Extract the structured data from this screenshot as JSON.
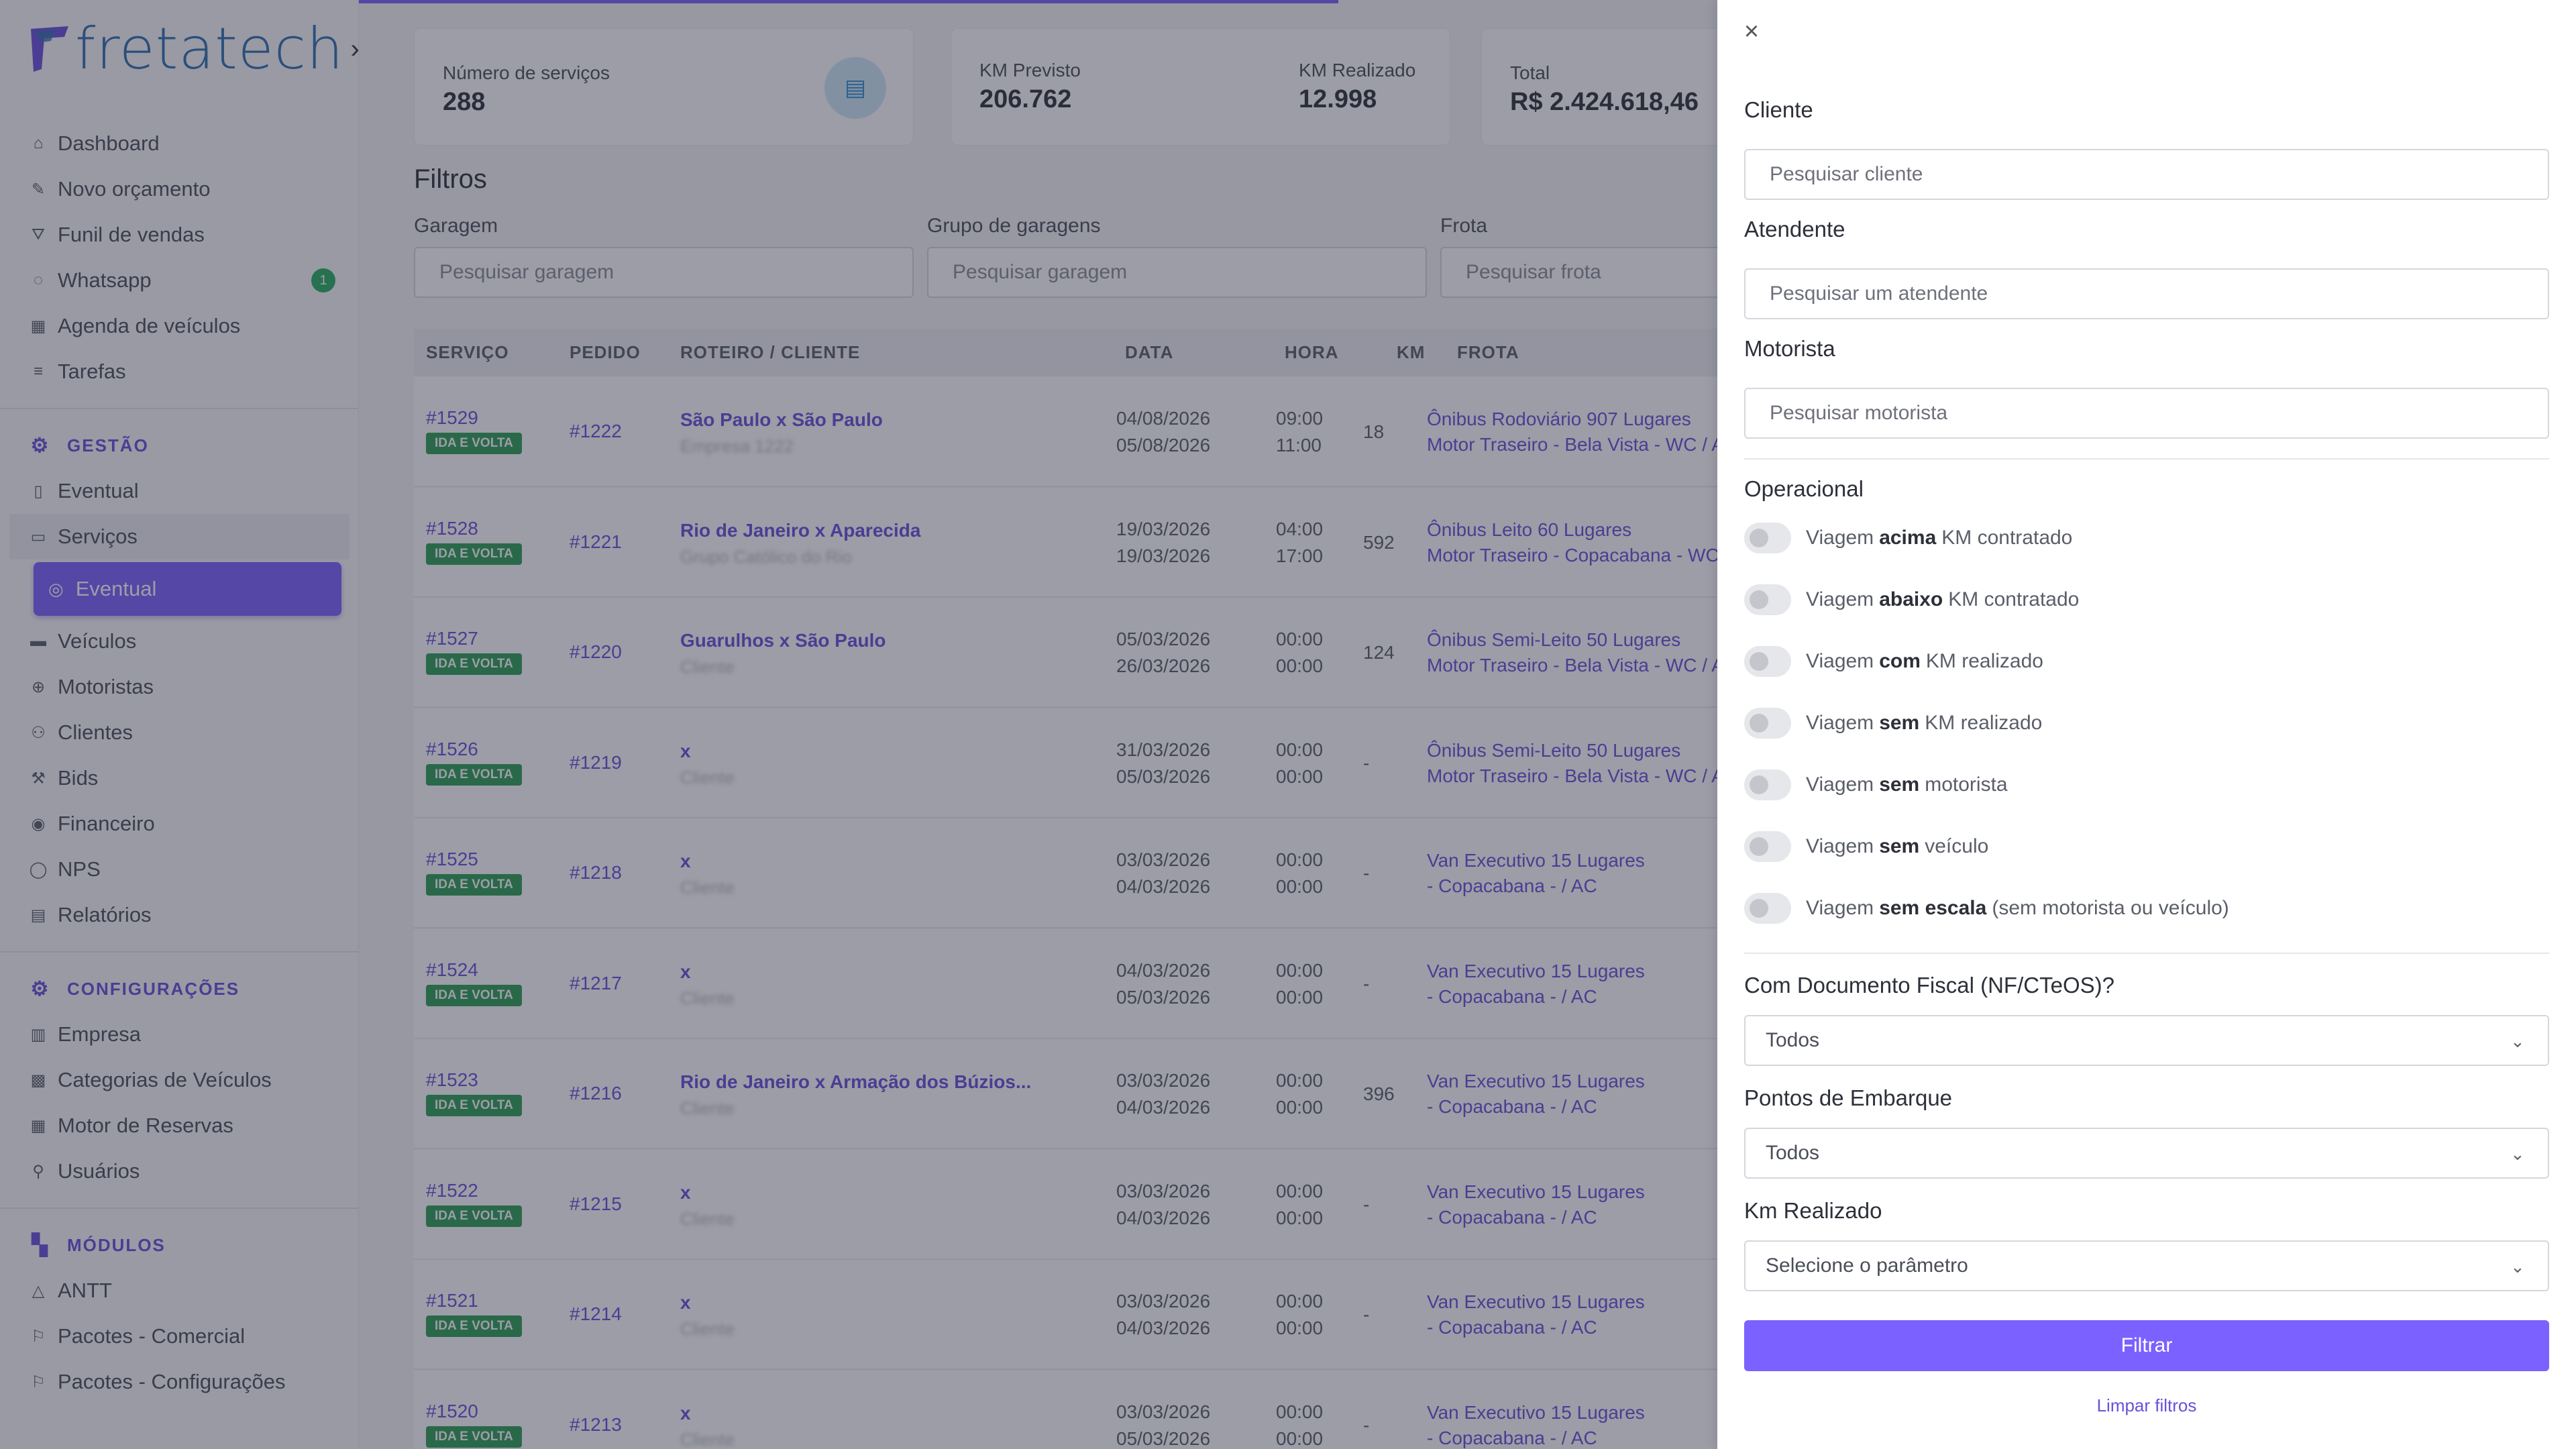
{
  "brand": {
    "name_a": "freta",
    "name_b": "tech",
    "chevron": "›"
  },
  "sidebar": {
    "items_top": [
      {
        "icon": "home-icon",
        "glyph": "⌂",
        "label": "Dashboard"
      },
      {
        "icon": "edit-icon",
        "glyph": "✎",
        "label": "Novo orçamento"
      },
      {
        "icon": "funnel-icon",
        "glyph": "⛛",
        "label": "Funil de vendas"
      },
      {
        "icon": "whatsapp-icon",
        "glyph": "◌",
        "label": "Whatsapp",
        "badge": "1"
      },
      {
        "icon": "calendar-icon",
        "glyph": "▦",
        "label": "Agenda de veículos"
      },
      {
        "icon": "list-icon",
        "glyph": "≡",
        "label": "Tarefas"
      }
    ],
    "gestao": {
      "title": "GESTÃO",
      "items": [
        {
          "icon": "file-icon",
          "glyph": "▯",
          "label": "Eventual"
        },
        {
          "icon": "services-icon",
          "glyph": "▭",
          "label": "Serviços"
        },
        {
          "icon": "circle-icon",
          "glyph": "◎",
          "label": "Eventual",
          "active": true
        },
        {
          "icon": "bus-icon",
          "glyph": "▬",
          "label": "Veículos"
        },
        {
          "icon": "steering-icon",
          "glyph": "⊕",
          "label": "Motoristas"
        },
        {
          "icon": "users-icon",
          "glyph": "⚇",
          "label": "Clientes"
        },
        {
          "icon": "gavel-icon",
          "glyph": "⚒",
          "label": "Bids"
        },
        {
          "icon": "money-icon",
          "glyph": "◉",
          "label": "Financeiro"
        },
        {
          "icon": "chat-icon",
          "glyph": "◯",
          "label": "NPS"
        },
        {
          "icon": "report-icon",
          "glyph": "▤",
          "label": "Relatórios"
        }
      ]
    },
    "config": {
      "title": "CONFIGURAÇÕES",
      "items": [
        {
          "icon": "building-icon",
          "glyph": "▥",
          "label": "Empresa"
        },
        {
          "icon": "grid-icon",
          "glyph": "▩",
          "label": "Categorias de Veículos"
        },
        {
          "icon": "table-icon",
          "glyph": "▦",
          "label": "Motor de Reservas"
        },
        {
          "icon": "user-icon",
          "glyph": "⚲",
          "label": "Usuários"
        }
      ]
    },
    "modulos": {
      "title": "MÓDULOS",
      "items": [
        {
          "icon": "warning-icon",
          "glyph": "△",
          "label": "ANTT"
        },
        {
          "icon": "package-icon",
          "glyph": "⚐",
          "label": "Pacotes - Comercial"
        },
        {
          "icon": "package-config-icon",
          "glyph": "⚐",
          "label": "Pacotes - Configurações"
        }
      ]
    }
  },
  "stats": {
    "services_label": "Número de serviços",
    "services_value": "288",
    "km_prev_label": "KM Previsto",
    "km_prev_value": "206.762",
    "km_real_label": "KM Realizado",
    "km_real_value": "12.998",
    "total_label": "Total",
    "total_value": "R$ 2.424.618,46"
  },
  "filters": {
    "title": "Filtros",
    "garagem_label": "Garagem",
    "garagem_placeholder": "Pesquisar garagem",
    "grupo_label": "Grupo de garagens",
    "grupo_placeholder": "Pesquisar garagem",
    "frota_label": "Frota",
    "frota_placeholder": "Pesquisar frota"
  },
  "table": {
    "headers": [
      "SERVIÇO",
      "PEDIDO",
      "ROTEIRO / CLIENTE",
      "DATA",
      "HORA",
      "KM",
      "FROTA"
    ],
    "rows": [
      {
        "svc": "#1529",
        "tag": "IDA E VOLTA",
        "ped": "#1222",
        "route": "São Paulo x São Paulo",
        "client": "Empresa 1222",
        "d1": "04/08/2026",
        "d2": "05/08/2026",
        "h1": "09:00",
        "h2": "11:00",
        "km": "18",
        "f1": "Ônibus Rodoviário 907 Lugares",
        "f2": "Motor Traseiro - Bela Vista - WC / AC"
      },
      {
        "svc": "#1528",
        "tag": "IDA E VOLTA",
        "ped": "#1221",
        "route": "Rio de Janeiro x Aparecida",
        "client": "Grupo Católico do Rio",
        "d1": "19/03/2026",
        "d2": "19/03/2026",
        "h1": "04:00",
        "h2": "17:00",
        "km": "592",
        "f1": "Ônibus Leito 60 Lugares",
        "f2": "Motor Traseiro - Copacabana - WC / AC"
      },
      {
        "svc": "#1527",
        "tag": "IDA E VOLTA",
        "ped": "#1220",
        "route": "Guarulhos x São Paulo",
        "client": "Cliente",
        "d1": "05/03/2026",
        "d2": "26/03/2026",
        "h1": "00:00",
        "h2": "00:00",
        "km": "124",
        "f1": "Ônibus Semi-Leito 50 Lugares",
        "f2": "Motor Traseiro - Bela Vista - WC / AC"
      },
      {
        "svc": "#1526",
        "tag": "IDA E VOLTA",
        "ped": "#1219",
        "route": "x",
        "client": "Cliente",
        "d1": "31/03/2026",
        "d2": "05/03/2026",
        "h1": "00:00",
        "h2": "00:00",
        "km": "-",
        "f1": "Ônibus Semi-Leito 50 Lugares",
        "f2": "Motor Traseiro - Bela Vista - WC / AC"
      },
      {
        "svc": "#1525",
        "tag": "IDA E VOLTA",
        "ped": "#1218",
        "route": "x",
        "client": "Cliente",
        "d1": "03/03/2026",
        "d2": "04/03/2026",
        "h1": "00:00",
        "h2": "00:00",
        "km": "-",
        "f1": "Van Executivo 15 Lugares",
        "f2": "- Copacabana - / AC"
      },
      {
        "svc": "#1524",
        "tag": "IDA E VOLTA",
        "ped": "#1217",
        "route": "x",
        "client": "Cliente",
        "d1": "04/03/2026",
        "d2": "05/03/2026",
        "h1": "00:00",
        "h2": "00:00",
        "km": "-",
        "f1": "Van Executivo 15 Lugares",
        "f2": "- Copacabana - / AC"
      },
      {
        "svc": "#1523",
        "tag": "IDA E VOLTA",
        "ped": "#1216",
        "route": "Rio de Janeiro x Armação dos Búzios...",
        "client": "Cliente",
        "d1": "03/03/2026",
        "d2": "04/03/2026",
        "h1": "00:00",
        "h2": "00:00",
        "km": "396",
        "f1": "Van Executivo 15 Lugares",
        "f2": "- Copacabana - / AC"
      },
      {
        "svc": "#1522",
        "tag": "IDA E VOLTA",
        "ped": "#1215",
        "route": "x",
        "client": "Cliente",
        "d1": "03/03/2026",
        "d2": "04/03/2026",
        "h1": "00:00",
        "h2": "00:00",
        "km": "-",
        "f1": "Van Executivo 15 Lugares",
        "f2": "- Copacabana - / AC"
      },
      {
        "svc": "#1521",
        "tag": "IDA E VOLTA",
        "ped": "#1214",
        "route": "x",
        "client": "Cliente",
        "d1": "03/03/2026",
        "d2": "04/03/2026",
        "h1": "00:00",
        "h2": "00:00",
        "km": "-",
        "f1": "Van Executivo 15 Lugares",
        "f2": "- Copacabana - / AC"
      },
      {
        "svc": "#1520",
        "tag": "IDA E VOLTA",
        "ped": "#1213",
        "route": "x",
        "client": "Cliente",
        "d1": "03/03/2026",
        "d2": "05/03/2026",
        "h1": "00:00",
        "h2": "00:00",
        "km": "-",
        "f1": "Van Executivo 15 Lugares",
        "f2": "- Copacabana - / AC"
      }
    ]
  },
  "drawer": {
    "close": "×",
    "cliente_label": "Cliente",
    "cliente_placeholder": "Pesquisar cliente",
    "atendente_label": "Atendente",
    "atendente_placeholder": "Pesquisar um atendente",
    "motorista_label": "Motorista",
    "motorista_placeholder": "Pesquisar motorista",
    "operacional_label": "Operacional",
    "toggles": [
      {
        "pre": "Viagem",
        "bold": "acima",
        "post": "KM contratado"
      },
      {
        "pre": "Viagem",
        "bold": "abaixo",
        "post": "KM contratado"
      },
      {
        "pre": "Viagem",
        "bold": "com",
        "post": "KM realizado"
      },
      {
        "pre": "Viagem",
        "bold": "sem",
        "post": "KM realizado"
      },
      {
        "pre": "Viagem",
        "bold": "sem",
        "post": "motorista"
      },
      {
        "pre": "Viagem",
        "bold": "sem",
        "post": "veículo"
      },
      {
        "pre": "Viagem",
        "bold": "sem escala",
        "post": "(sem motorista ou veículo)"
      }
    ],
    "doc_label": "Com Documento Fiscal (NF/CTeOS)?",
    "doc_value": "Todos",
    "pontos_label": "Pontos de Embarque",
    "pontos_value": "Todos",
    "km_label": "Km Realizado",
    "km_value": "Selecione o parâmetro",
    "filter_button": "Filtrar",
    "clear_link": "Limpar filtros"
  }
}
